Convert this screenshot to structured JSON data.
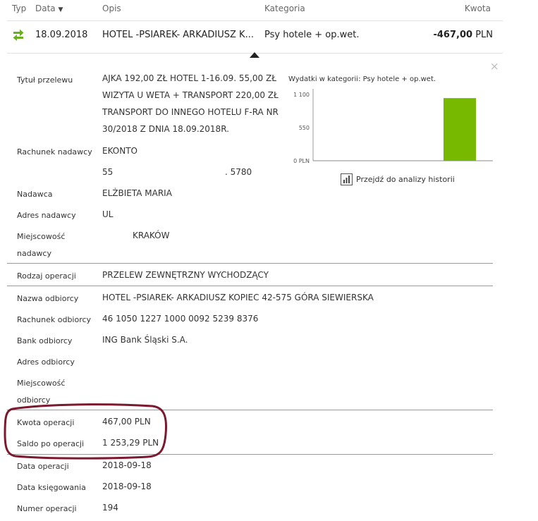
{
  "header": {
    "typ": "Typ",
    "data": "Data",
    "opis": "Opis",
    "kategoria": "Kategoria",
    "kwota": "Kwota"
  },
  "transaction": {
    "date": "18.09.2018",
    "description": "HOTEL -PSIAREK- ARKADIUSZ K...",
    "category": "Psy hotele + op.wet.",
    "amount": "-467,00",
    "currency": "PLN",
    "icon": "transfer-arrows-icon",
    "icon_color": "#6ab023"
  },
  "details": {
    "tytul_label": "Tytuł przelewu",
    "tytul_lines": [
      "AJKA 192,00 ZŁ HOTEL 1-16.09. 55,00 ZŁ",
      "WIZYTA U WETA + TRANSPORT 220,00 ZŁ",
      "TRANSPORT DO INNEGO HOTELU F-RA NR",
      "30/2018 Z DNIA 18.09.2018R."
    ],
    "rachunek_nadawcy_label": "Rachunek nadawcy",
    "rachunek_nadawcy_line1": "EKONTO",
    "rachunek_nadawcy_line2a": "55",
    "rachunek_nadawcy_line2b": ". 5780",
    "nadawca_label": "Nadawca",
    "nadawca_value": "ELŻBIETA MARIA",
    "adres_nadawcy_label": "Adres nadawcy",
    "adres_nadawcy_value": "UL",
    "miejscowosc_nadawcy_label1": "Miejscowość",
    "miejscowosc_nadawcy_label2": "nadawcy",
    "miejscowosc_nadawcy_value": "KRAKÓW",
    "rodzaj_operacji_label": "Rodzaj operacji",
    "rodzaj_operacji_value": "PRZELEW ZEWNĘTRZNY WYCHODZĄCY",
    "nazwa_odbiorcy_label": "Nazwa odbiorcy",
    "nazwa_odbiorcy_value": "HOTEL -PSIAREK- ARKADIUSZ KOPIEC 42-575 GÓRA SIEWIERSKA",
    "rachunek_odbiorcy_label": "Rachunek odbiorcy",
    "rachunek_odbiorcy_value": "46 1050 1227 1000 0092 5239 8376",
    "bank_odbiorcy_label": "Bank odbiorcy",
    "bank_odbiorcy_value": "ING Bank Śląski S.A.",
    "adres_odbiorcy_label": "Adres odbiorcy",
    "miejscowosc_odbiorcy_label1": "Miejscowość",
    "miejscowosc_odbiorcy_label2": "odbiorcy",
    "kwota_operacji_label": "Kwota operacji",
    "kwota_operacji_value": "467,00 PLN",
    "saldo_label": "Saldo po operacji",
    "saldo_value": "1 253,29 PLN",
    "data_operacji_label": "Data operacji",
    "data_operacji_value": "2018-09-18",
    "data_ksiegowania_label": "Data księgowania",
    "data_ksiegowania_value": "2018-09-18",
    "numer_operacji_label": "Numer operacji",
    "numer_operacji_value": "194"
  },
  "chart_panel": {
    "title": "Wydatki w kategorii:  Psy hotele + op.wet.",
    "link": "Przejdź do analizy historii",
    "close": "×"
  },
  "chart_data": {
    "type": "bar",
    "categories": [
      ""
    ],
    "values": [
      1040
    ],
    "title": "Wydatki w kategorii:  Psy hotele + op.wet.",
    "xlabel": "",
    "ylabel": "",
    "ylim": [
      0,
      1100
    ],
    "ytick_values": [
      1100,
      550,
      0
    ],
    "ytick_labels": [
      "1 100",
      "550",
      "0 PLN"
    ],
    "color": "#76b900"
  },
  "colors": {
    "accent": "#6ab023",
    "bar": "#76b900",
    "highlight_ring": "#7b1a2e"
  }
}
